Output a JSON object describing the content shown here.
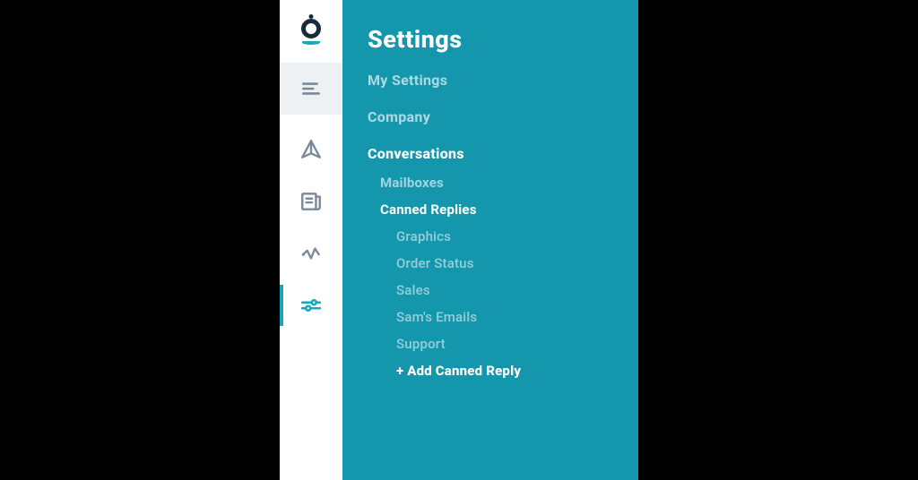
{
  "panel": {
    "title": "Settings",
    "links": {
      "my_settings": "My Settings",
      "company": "Company"
    },
    "conversations": {
      "heading": "Conversations",
      "mailboxes": "Mailboxes",
      "canned_replies": "Canned Replies",
      "replies": [
        "Graphics",
        "Order Status",
        "Sales",
        "Sam's Emails",
        "Support"
      ],
      "add": "+ Add Canned Reply"
    }
  }
}
